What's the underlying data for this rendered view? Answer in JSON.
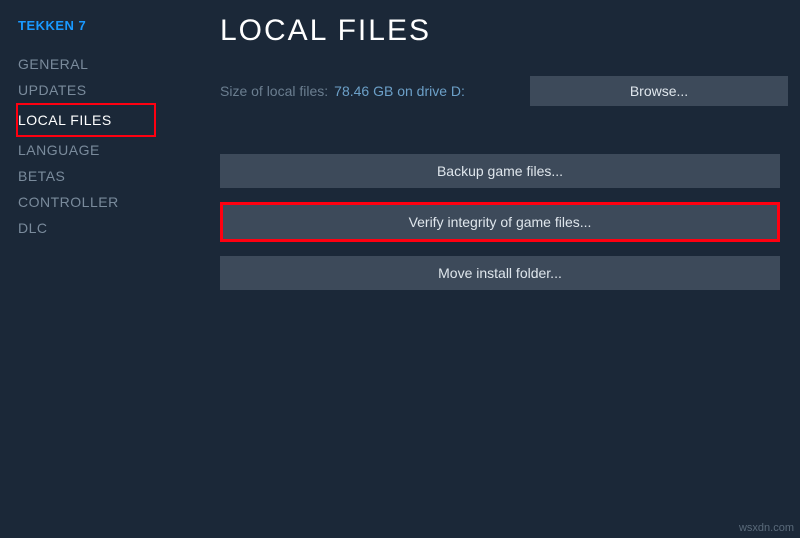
{
  "game_title": "TEKKEN 7",
  "sidebar": {
    "items": [
      {
        "label": "GENERAL",
        "active": false
      },
      {
        "label": "UPDATES",
        "active": false
      },
      {
        "label": "LOCAL FILES",
        "active": true
      },
      {
        "label": "LANGUAGE",
        "active": false
      },
      {
        "label": "BETAS",
        "active": false
      },
      {
        "label": "CONTROLLER",
        "active": false
      },
      {
        "label": "DLC",
        "active": false
      }
    ]
  },
  "main": {
    "title": "LOCAL FILES",
    "size_label": "Size of local files:",
    "size_value": "78.46 GB on drive D:",
    "browse_label": "Browse...",
    "backup_label": "Backup game files...",
    "verify_label": "Verify integrity of game files...",
    "move_label": "Move install folder..."
  },
  "watermark": "wsxdn.com"
}
